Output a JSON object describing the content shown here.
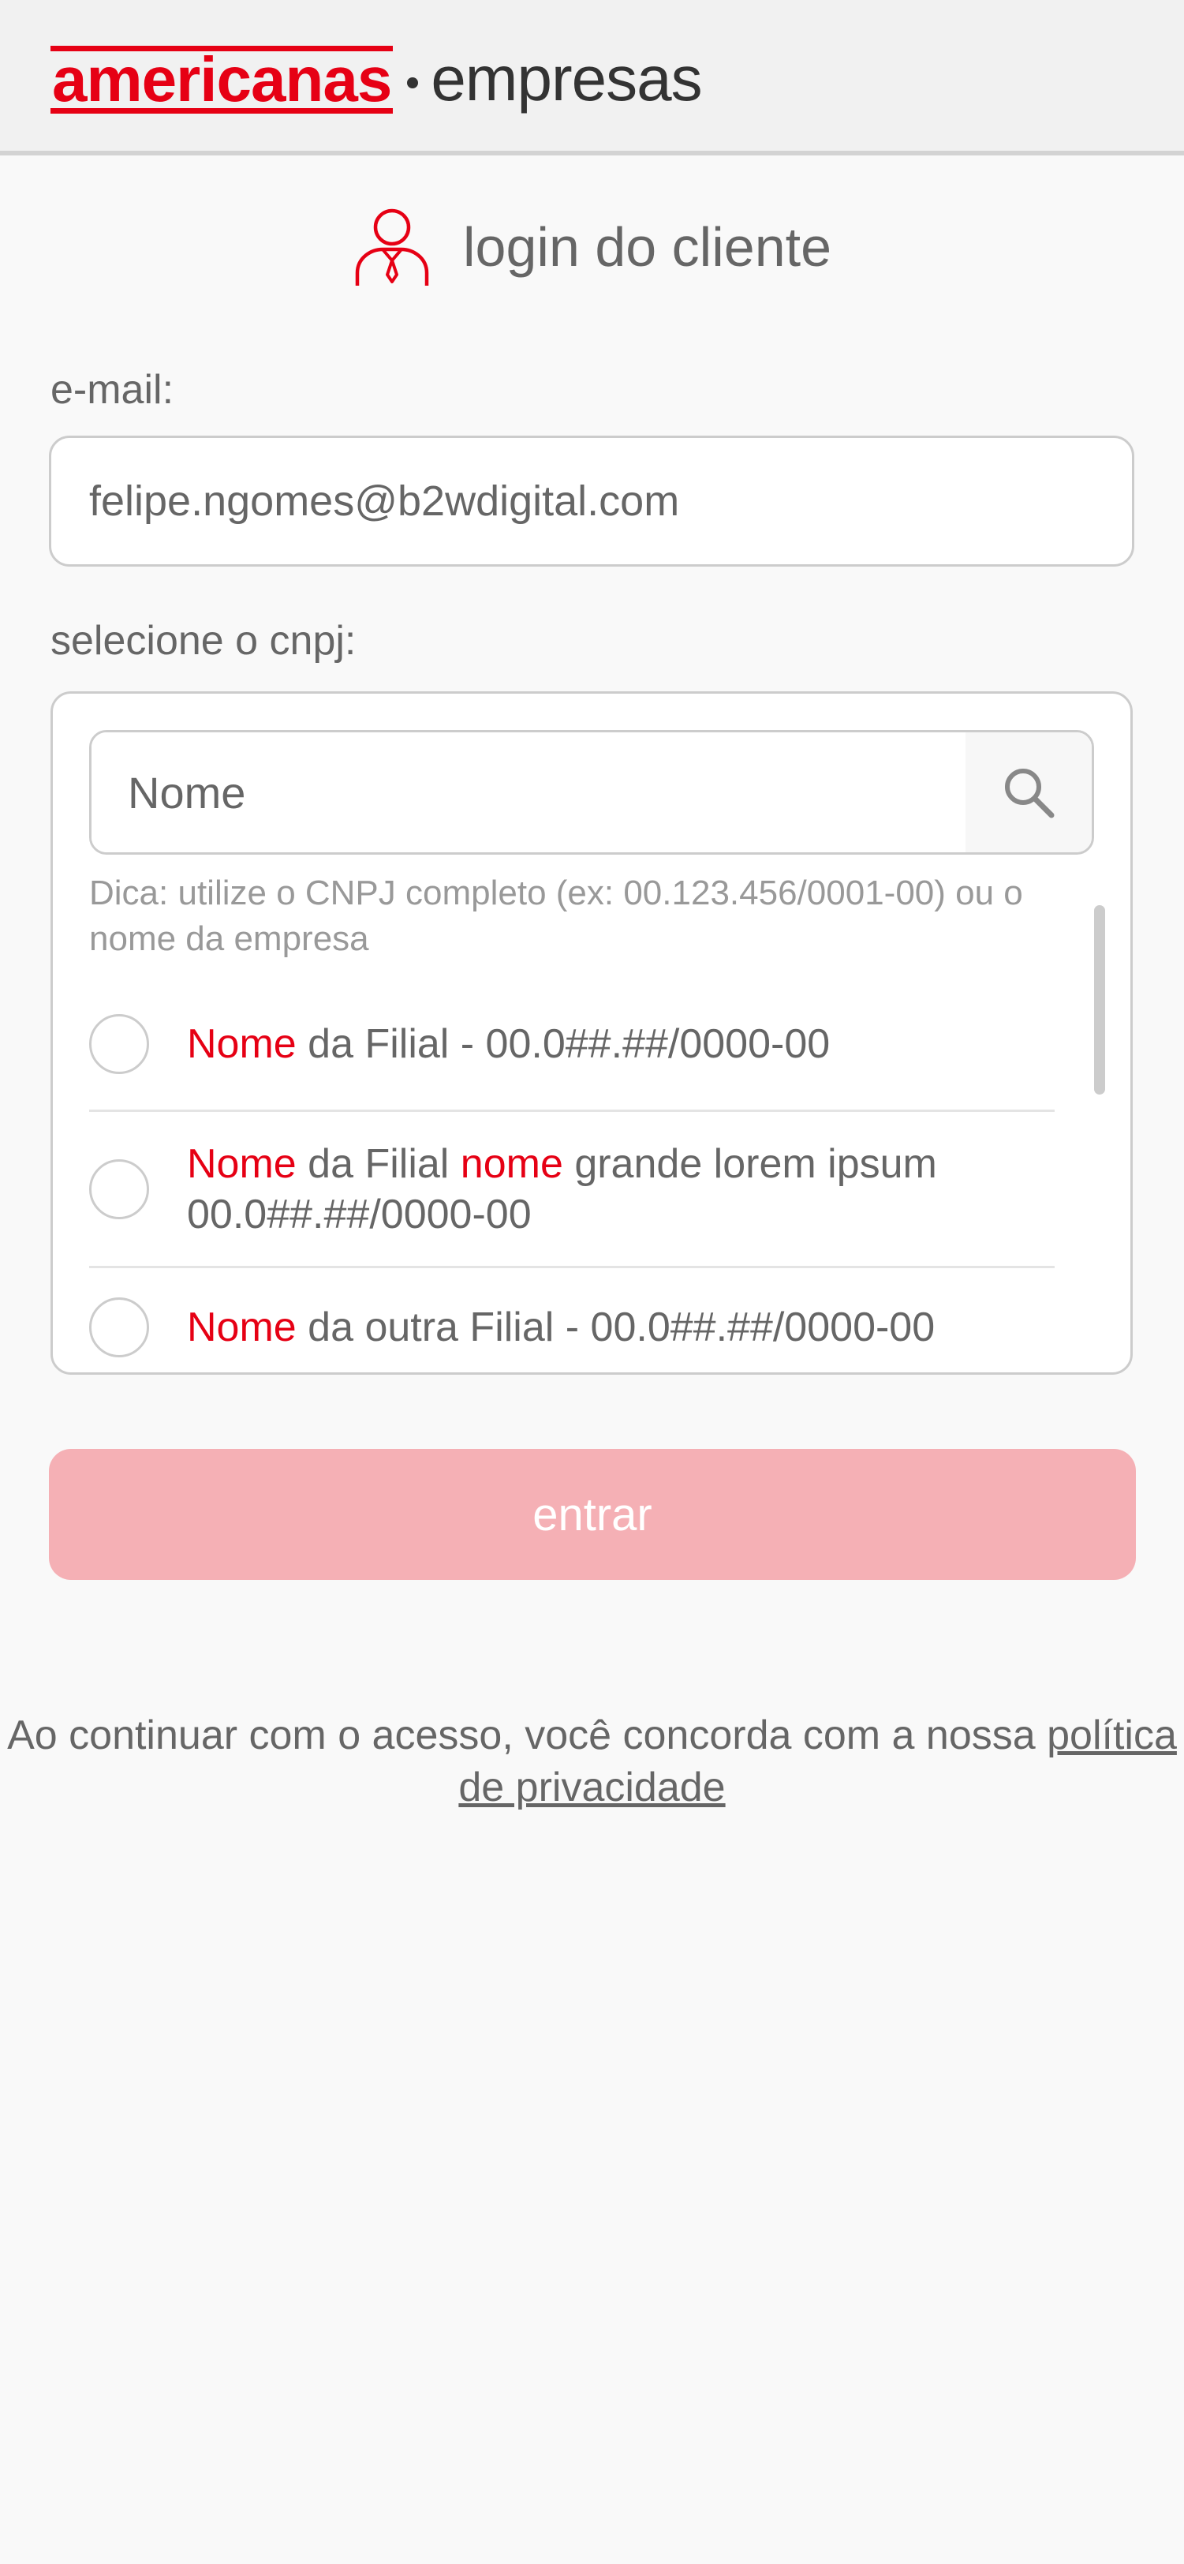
{
  "header": {
    "brand_main": "americanas",
    "brand_sub": "empresas"
  },
  "page": {
    "title": "login do cliente"
  },
  "email": {
    "label": "e-mail:",
    "value": "felipe.ngomes@b2wdigital.com"
  },
  "cnpj": {
    "label": "selecione o cnpj:",
    "search_placeholder": "Nome",
    "hint": "Dica: utilize o CNPJ completo (ex: 00.123.456/0001-00) ou o nome da empresa",
    "options": [
      {
        "parts": [
          {
            "text": "Nome",
            "highlight": true
          },
          {
            "text": " da Filial - 00.0##.##/0000-00",
            "highlight": false
          }
        ]
      },
      {
        "parts": [
          {
            "text": "Nome",
            "highlight": true
          },
          {
            "text": " da Filial ",
            "highlight": false
          },
          {
            "text": "nome",
            "highlight": true
          },
          {
            "text": " grande lorem ipsum 00.0##.##/0000-00",
            "highlight": false
          }
        ]
      },
      {
        "parts": [
          {
            "text": "Nome",
            "highlight": true
          },
          {
            "text": " da outra Filial - 00.0##.##/0000-00",
            "highlight": false
          }
        ]
      }
    ]
  },
  "submit": {
    "label": "entrar"
  },
  "footer": {
    "text_before": "Ao continuar com o acesso, você concorda com a nossa ",
    "link": "política de privacidade"
  },
  "colors": {
    "brand_red": "#e60014",
    "button_disabled": "#f5b0b5",
    "header_bg": "#f1f1f1"
  },
  "icons": [
    "user-tie-icon",
    "search-icon"
  ]
}
